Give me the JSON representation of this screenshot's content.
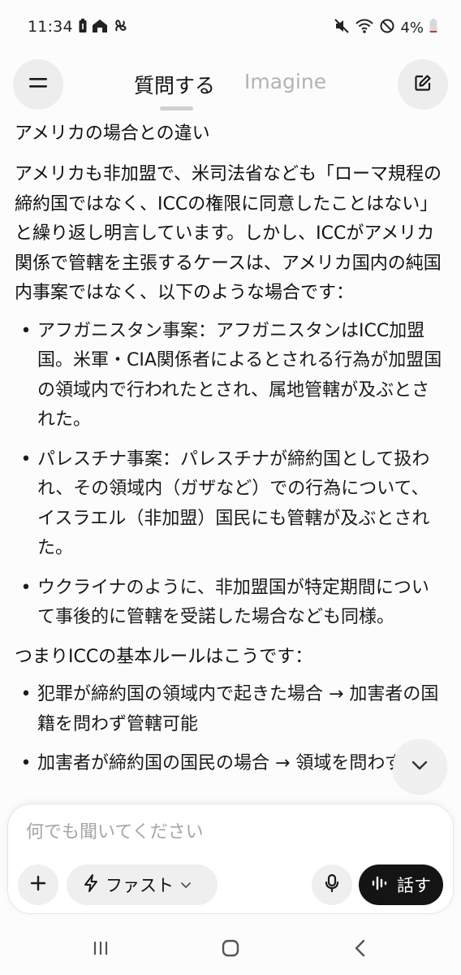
{
  "status_bar": {
    "time": "11:34",
    "battery_text": "4%",
    "left_icons": [
      "battery-saver-icon",
      "home-icon",
      "fan-icon"
    ],
    "right_icons": [
      "mute-icon",
      "wifi-icon",
      "do-not-disturb-icon",
      "battery-icon"
    ]
  },
  "header": {
    "tabs": [
      {
        "label": "質問する",
        "active": true
      },
      {
        "label": "Imagine",
        "active": false
      }
    ]
  },
  "content": {
    "heading": "アメリカの場合との違い",
    "intro": "アメリカも非加盟で、米司法省なども「ローマ規程の締約国ではなく、ICCの権限に同意したことはない」と繰り返し明言しています。しかし、ICCがアメリカ関係で管轄を主張するケースは、アメリカ国内の純国内事案ではなく、以下のような場合です：",
    "bullets": [
      "アフガニスタン事案：アフガニスタンはICC加盟国。米軍・CIA関係者によるとされる行為が加盟国の領域内で行われたとされ、属地管轄が及ぶとされた。",
      "パレスチナ事案：パレスチナが締約国として扱われ、その領域内（ガザなど）での行為について、イスラエル（非加盟）国民にも管轄が及ぶとされた。",
      "ウクライナのように、非加盟国が特定期間について事後的に管轄を受諾した場合なども同様。"
    ],
    "summary": "つまりICCの基本ルールはこうです：",
    "rule_bullets": [
      "犯罪が締約国の領域内で起きた場合 → 加害者の国籍を問わず管轄可能",
      "加害者が締約国の国民の場合 → 領域を問わず管"
    ]
  },
  "composer": {
    "placeholder": "何でも聞いてください",
    "model_label": "ファスト",
    "speak_label": "話す"
  },
  "colors": {
    "background": "#fcfcfc",
    "text": "#111111",
    "inactive_tab": "#b3b3b3",
    "speak_button": "#141414"
  }
}
